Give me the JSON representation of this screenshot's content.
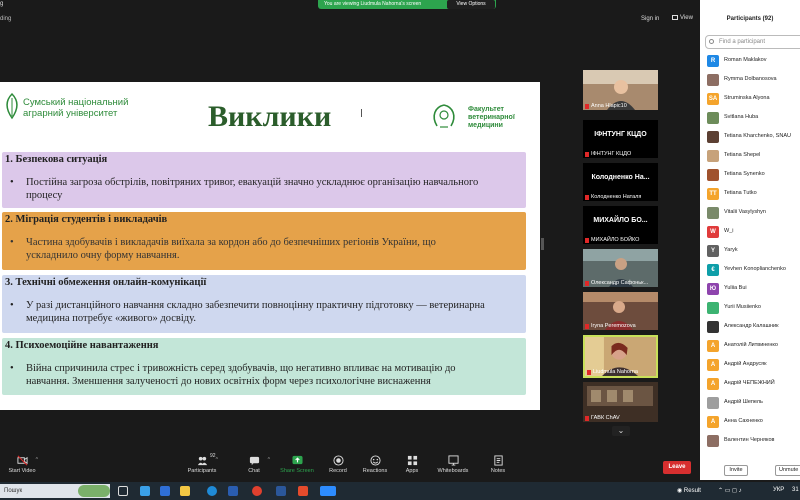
{
  "window": {
    "app_label": "g",
    "sharing_banner": "You are viewing Liudmula Nahorna's screen",
    "view_options": "View Options",
    "left_label": "ding",
    "sign_in": "Sign in",
    "view": "View"
  },
  "slide": {
    "university": [
      "Сумський національний",
      "аграрний університет"
    ],
    "title": "Виклики",
    "faculty": [
      "Факультет",
      "ветеринарної",
      "медицини"
    ],
    "sections": [
      {
        "heading": "1. Безпекова ситуація",
        "bullet": "•",
        "lines": [
          "Постійна загроза обстрілів, повітряних тривог, евакуацій значно ускладнює організацію навчального",
          "процесу"
        ]
      },
      {
        "heading": "2. Міграція студентів і викладачів",
        "bullet": "•",
        "lines": [
          "Частина здобувачів і викладачів виїхала за кордон або до безпечніших регіонів України, що",
          "ускладнило очну форму навчання."
        ]
      },
      {
        "heading": "3. Технічні обмеження онлайн-комунікації",
        "bullet": "•",
        "lines": [
          "У разі дистанційного навчання складно забезпечити повноцінну практичну підготовку — ветеринарна",
          "медицина потребує «живого» досвіду."
        ]
      },
      {
        "heading": "4. Психоемоційне навантаження",
        "bullet": "•",
        "lines": [
          "Війна спричинила стрес і тривожність серед здобувачів, що негативно впливає на мотивацію до",
          "навчання. Зменшення залученості до нових освітніх форм через психологічне виснаження"
        ]
      }
    ]
  },
  "gallery": [
    {
      "name": "Anna Hlapic10",
      "big": ""
    },
    {
      "name": "ІФНТУНГ КЦДО",
      "big": "ІФНТУНГ КЦДО"
    },
    {
      "name": "Колодненко Наталя",
      "big": "Колодненко На..."
    },
    {
      "name": "МИХАЙЛО БОЙКО",
      "big": "МИХАЙЛО БО..."
    },
    {
      "name": "Олександр Сафоньк...",
      "big": ""
    },
    {
      "name": "Iryna Peremozova",
      "big": ""
    },
    {
      "name": "Liudmula Nahorna",
      "big": ""
    },
    {
      "name": "ГАВК ChAV",
      "big": ""
    }
  ],
  "gallery_more": "⌄",
  "participants": {
    "title": "Participants (92)",
    "search_placeholder": "Find a participant",
    "items": [
      {
        "initial": "R",
        "name": "Roman Maklakov",
        "color": "#1e88e5"
      },
      {
        "initial": "",
        "name": "Rymma Dolbanosova",
        "color": "#8d6e63"
      },
      {
        "initial": "SA",
        "name": "Struminska Alyona",
        "color": "#f4a42c"
      },
      {
        "initial": "",
        "name": "Svitlana Huba",
        "color": "#6d8c5a"
      },
      {
        "initial": "",
        "name": "Tetiana Kharchenko, SNAU",
        "color": "#5c4033"
      },
      {
        "initial": "",
        "name": "Tetiana Shepel",
        "color": "#c7a27a"
      },
      {
        "initial": "",
        "name": "Tetiana Synenko",
        "color": "#a0522d"
      },
      {
        "initial": "TT",
        "name": "Tetiana Tutko",
        "color": "#f4a42c"
      },
      {
        "initial": "",
        "name": "Vitalii Vasylyshyn",
        "color": "#7a8a6a"
      },
      {
        "initial": "W",
        "name": "W_i",
        "color": "#e03b3b"
      },
      {
        "initial": "Y",
        "name": "Yaryk",
        "color": "#616161"
      },
      {
        "initial": "€",
        "name": "Yevhen Konoplianchenko",
        "color": "#0e9ea8"
      },
      {
        "initial": "Ю",
        "name": "Yuliia Bui",
        "color": "#8e44ad"
      },
      {
        "initial": "",
        "name": "Yurii Musiienko",
        "color": "#3cb371"
      },
      {
        "initial": "",
        "name": "Александр Калашник",
        "color": "#333333"
      },
      {
        "initial": "А",
        "name": "Анатолій Литвиненко",
        "color": "#f4a42c"
      },
      {
        "initial": "А",
        "name": "Андрій Андрусяк",
        "color": "#f4a42c"
      },
      {
        "initial": "А",
        "name": "Андрій ЧЕПЕЖНИЙ",
        "color": "#f4a42c"
      },
      {
        "initial": "",
        "name": "Андрій Шепель",
        "color": "#9e9e9e"
      },
      {
        "initial": "А",
        "name": "Анна Сахненко",
        "color": "#f4a42c"
      },
      {
        "initial": "",
        "name": "Валентин Черняков",
        "color": "#8d6e63"
      }
    ],
    "invite": "Invite",
    "unmute": "Unmute"
  },
  "toolbar": {
    "start_video": "Start Video",
    "participants": "Participants",
    "participants_count": "92",
    "chat": "Chat",
    "share_screen": "Share Screen",
    "record": "Record",
    "reactions": "Reactions",
    "apps": "Apps",
    "whiteboards": "Whiteboards",
    "notes": "Notes",
    "leave": "Leave"
  },
  "taskbar": {
    "search": "Пошук",
    "result": "Result",
    "lang": "УКР",
    "clock": "31"
  },
  "colors": {
    "share_green": "#2da44e",
    "leave_red": "#d72f2f",
    "slide_title": "#2b5d2b",
    "box1": "#dcc8ea",
    "box2": "#e5a24a",
    "box3": "#cfd8ef",
    "box4": "#c3e6d8"
  }
}
